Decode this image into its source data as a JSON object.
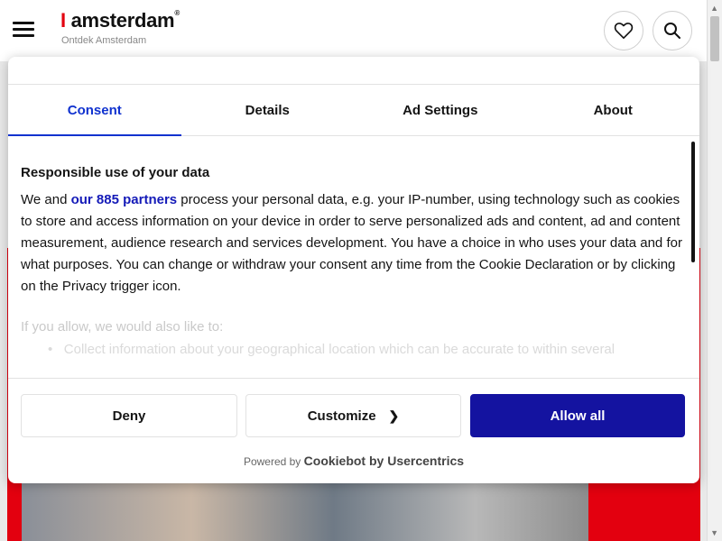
{
  "site": {
    "logo_prefix": "I",
    "logo_name": "amsterdam",
    "logo_mark": "®",
    "tagline": "Ontdek Amsterdam",
    "menu_icon": "hamburger-menu-icon",
    "favorites_icon": "heart-icon",
    "search_icon": "search-icon",
    "accent_color": "#e3000f"
  },
  "cookie_dialog": {
    "tabs": [
      {
        "label": "Consent",
        "active": true
      },
      {
        "label": "Details",
        "active": false
      },
      {
        "label": "Ad Settings",
        "active": false
      },
      {
        "label": "About",
        "active": false
      }
    ],
    "heading": "Responsible use of your data",
    "paragraph_start": "We and ",
    "partners_link": "our 885 partners",
    "paragraph_end": " process your personal data, e.g. your IP-number, using technology such as cookies to store and access information on your device in order to serve personalized ads and content, ad and content measurement, audience research and services development. You have a choice in who uses your data and for what purposes. You can change or withdraw your consent any time from the Cookie Declaration or by clicking on the Privacy trigger icon.",
    "faded_intro": "If you allow, we would also like to:",
    "faded_bullet": "Collect information about your geographical location which can be accurate to within several",
    "buttons": {
      "deny": "Deny",
      "customize": "Customize",
      "allow_all": "Allow all"
    },
    "powered_by_prefix": "Powered by",
    "powered_by_brand": "Cookiebot by Usercentrics",
    "primary_color": "#1413a0",
    "tab_active_color": "#1032cf"
  }
}
